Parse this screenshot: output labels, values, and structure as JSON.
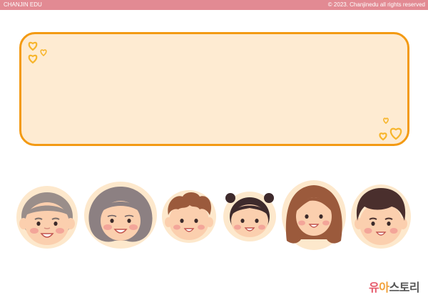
{
  "topbar": {
    "brand": "CHANJIN EDU",
    "copyright": "© 2023. Chanjinedu all rights reserved"
  },
  "colors": {
    "topbar": "#e28a93",
    "card_fill": "#feebd2",
    "card_border": "#f39a13",
    "heart": "#f7b52c",
    "face_outline": "#fde8cc",
    "skin": "#fbcfae",
    "cheek": "#f19a93"
  },
  "faces": [
    {
      "name": "grandfather-face",
      "hair": "#9a8e8a"
    },
    {
      "name": "grandmother-face",
      "hair": "#8c8082"
    },
    {
      "name": "boy-face",
      "hair": "#9b5a3c"
    },
    {
      "name": "girl-face",
      "hair": "#3e2a2c"
    },
    {
      "name": "mother-face",
      "hair": "#9b5a3c"
    },
    {
      "name": "father-face",
      "hair": "#4a2f2d"
    }
  ],
  "logo": {
    "part1": "유",
    "part2": "아",
    "part3": "스토리"
  },
  "icons": [
    "heart-cluster-icon",
    "face-icon",
    "yuastory-logo"
  ]
}
